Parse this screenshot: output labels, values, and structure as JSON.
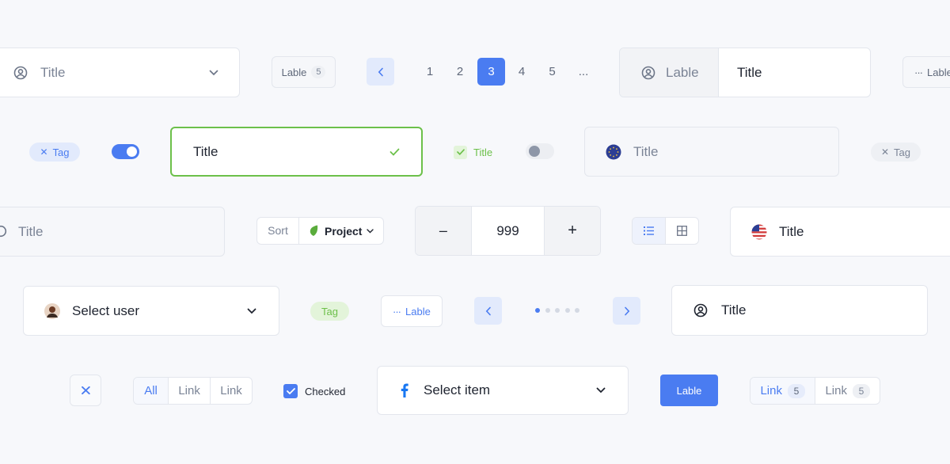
{
  "row1": {
    "select_title": "Title",
    "lable_badge": {
      "label": "Lable",
      "count": "5"
    },
    "pagination": {
      "pages": [
        "1",
        "2",
        "3",
        "4",
        "5"
      ],
      "ellipsis": "...",
      "active": "3"
    },
    "split": {
      "left": "Lable",
      "right": "Title"
    },
    "more_lable": "Lable"
  },
  "row2": {
    "tag_left": "Tag",
    "input_success": "Title",
    "checkbox_title": "Title",
    "flag_input": "Title",
    "tag_right": "Tag"
  },
  "row3": {
    "search_title": "Title",
    "sort": {
      "label": "Sort",
      "value": "Project"
    },
    "stepper": {
      "minus": "–",
      "value": "999",
      "plus": "+"
    },
    "flag_title": "Title"
  },
  "row4": {
    "select_user": "Select user",
    "tag_green": "Tag",
    "more_lable": "Lable",
    "title_card": "Title"
  },
  "row5": {
    "links": [
      "All",
      "Link",
      "Link"
    ],
    "checked_label": "Checked",
    "select_item": "Select item",
    "button_lable": "Lable",
    "link_badges": [
      {
        "label": "Link",
        "count": "5"
      },
      {
        "label": "Link",
        "count": "5"
      }
    ]
  },
  "colors": {
    "accent": "#4a7cf1",
    "success": "#6cc04a",
    "border": "#e3e6ed"
  }
}
